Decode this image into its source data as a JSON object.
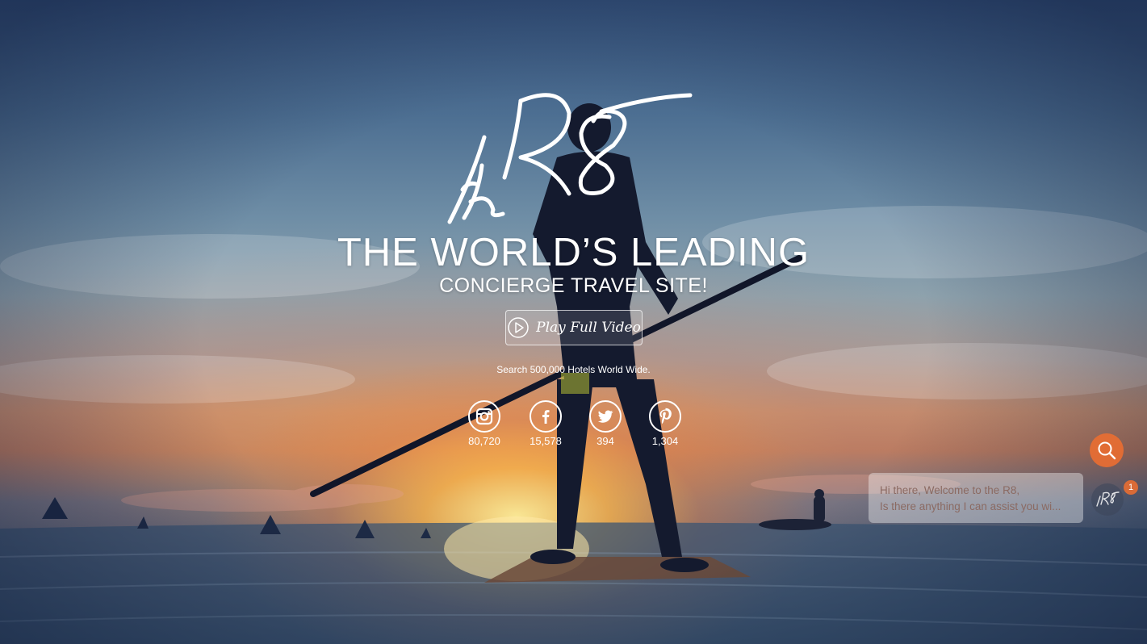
{
  "hero": {
    "headline": "THE WORLD’S LEADING",
    "subheadline": "CONCIERGE TRAVEL SITE!",
    "play_button_label": "Play Full Video",
    "tagline": "Search 500,000 Hotels World Wide."
  },
  "logo": {
    "icon": "the-r8-script-logo"
  },
  "socials": [
    {
      "network": "instagram",
      "icon": "instagram-icon",
      "count": "80,720"
    },
    {
      "network": "facebook",
      "icon": "facebook-icon",
      "count": "15,578"
    },
    {
      "network": "twitter",
      "icon": "twitter-icon",
      "count": "394"
    },
    {
      "network": "pinterest",
      "icon": "pinterest-icon",
      "count": "1,304"
    }
  ],
  "chat": {
    "line1": "Hi there, Welcome to the R8,",
    "line2": "Is there anything I can assist you wi...",
    "badge": "1"
  },
  "colors": {
    "accent": "#e86e32",
    "text": "#ffffff"
  }
}
